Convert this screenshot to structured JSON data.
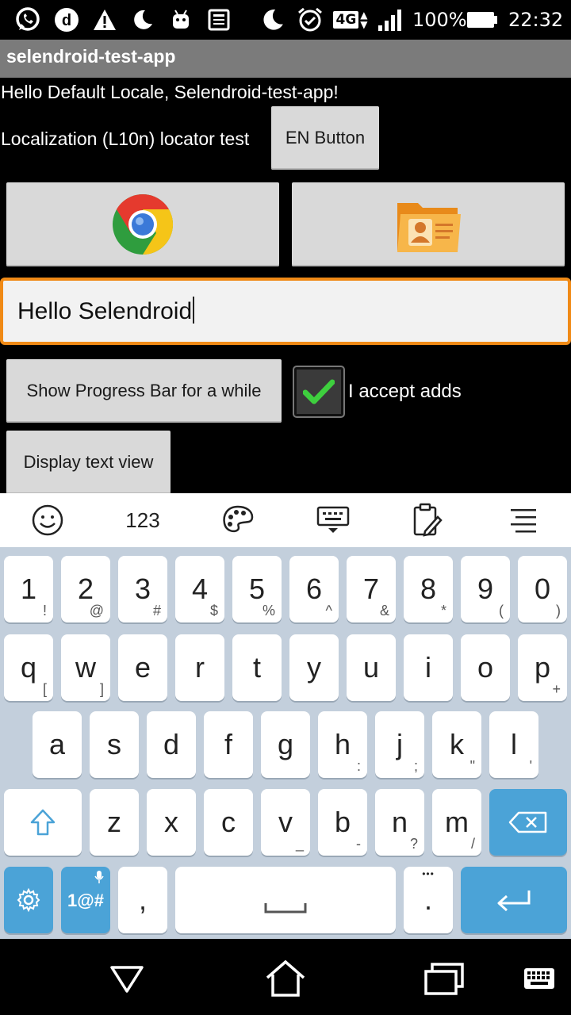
{
  "status": {
    "battery": "100%",
    "time": "22:32",
    "network": "4G"
  },
  "appbar": {
    "title": "selendroid-test-app"
  },
  "content": {
    "greeting": "Hello Default Locale, Selendroid-test-app!",
    "locator_label": "Localization (L10n) locator test",
    "en_button": "EN Button",
    "input_value": "Hello Selendroid",
    "progress_button": "Show Progress Bar for a while",
    "accept_label": "I accept adds",
    "accept_checked": true,
    "display_button": "Display text view"
  },
  "keyboard": {
    "toolbar": {
      "numbers": "123"
    },
    "row1": [
      {
        "k": "1",
        "s": "!"
      },
      {
        "k": "2",
        "s": "@"
      },
      {
        "k": "3",
        "s": "#"
      },
      {
        "k": "4",
        "s": "$"
      },
      {
        "k": "5",
        "s": "%"
      },
      {
        "k": "6",
        "s": "^"
      },
      {
        "k": "7",
        "s": "&"
      },
      {
        "k": "8",
        "s": "*"
      },
      {
        "k": "9",
        "s": "("
      },
      {
        "k": "0",
        "s": ")"
      }
    ],
    "row2": [
      {
        "k": "q",
        "s": "["
      },
      {
        "k": "w",
        "s": "]"
      },
      {
        "k": "e",
        "s": ""
      },
      {
        "k": "r",
        "s": ""
      },
      {
        "k": "t",
        "s": ""
      },
      {
        "k": "y",
        "s": ""
      },
      {
        "k": "u",
        "s": ""
      },
      {
        "k": "i",
        "s": ""
      },
      {
        "k": "o",
        "s": ""
      },
      {
        "k": "p",
        "s": "+"
      }
    ],
    "row3": [
      {
        "k": "a",
        "s": ""
      },
      {
        "k": "s",
        "s": ""
      },
      {
        "k": "d",
        "s": ""
      },
      {
        "k": "f",
        "s": ""
      },
      {
        "k": "g",
        "s": ""
      },
      {
        "k": "h",
        "s": ":"
      },
      {
        "k": "j",
        "s": ";"
      },
      {
        "k": "k",
        "s": "\""
      },
      {
        "k": "l",
        "s": "'"
      }
    ],
    "row4": [
      {
        "k": "z",
        "s": ""
      },
      {
        "k": "x",
        "s": ""
      },
      {
        "k": "c",
        "s": ""
      },
      {
        "k": "v",
        "s": "_"
      },
      {
        "k": "b",
        "s": "-"
      },
      {
        "k": "n",
        "s": "?"
      },
      {
        "k": "m",
        "s": "/"
      }
    ],
    "symbols_key": "1@#",
    "comma_key": ",",
    "period_key": ".",
    "period_extra": "•••"
  },
  "colors": {
    "accent": "#f08a16",
    "key_blue": "#4ba3d7",
    "keyboard_bg": "#c3cfdc",
    "check_green": "#3ecf3e"
  }
}
